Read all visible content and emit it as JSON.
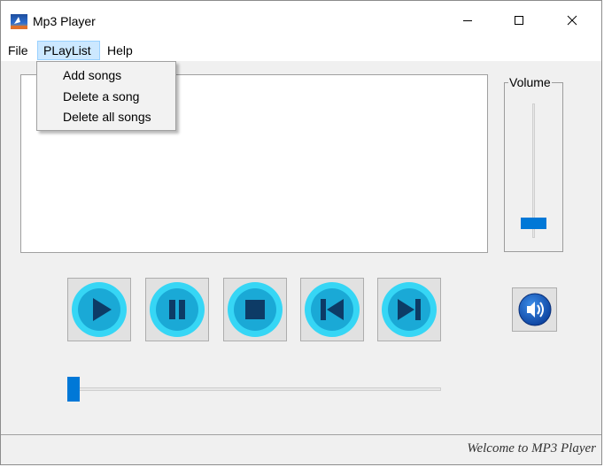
{
  "window": {
    "title": "Mp3 Player"
  },
  "menu": {
    "file": "File",
    "playlist": "PLayList",
    "help": "Help",
    "playlist_items": [
      "Add songs",
      "Delete a song",
      "Delete all songs"
    ]
  },
  "volume": {
    "label": "Volume",
    "level": 0.08
  },
  "controls": [
    "play-icon",
    "pause-icon",
    "stop-icon",
    "previous-icon",
    "next-icon"
  ],
  "seek": {
    "position": 0.0
  },
  "status": {
    "text": "Welcome to MP3 Player"
  },
  "colors": {
    "accent": "#0078d7",
    "button_ring": "#36d6f5",
    "menu_highlight": "#cce8ff"
  }
}
